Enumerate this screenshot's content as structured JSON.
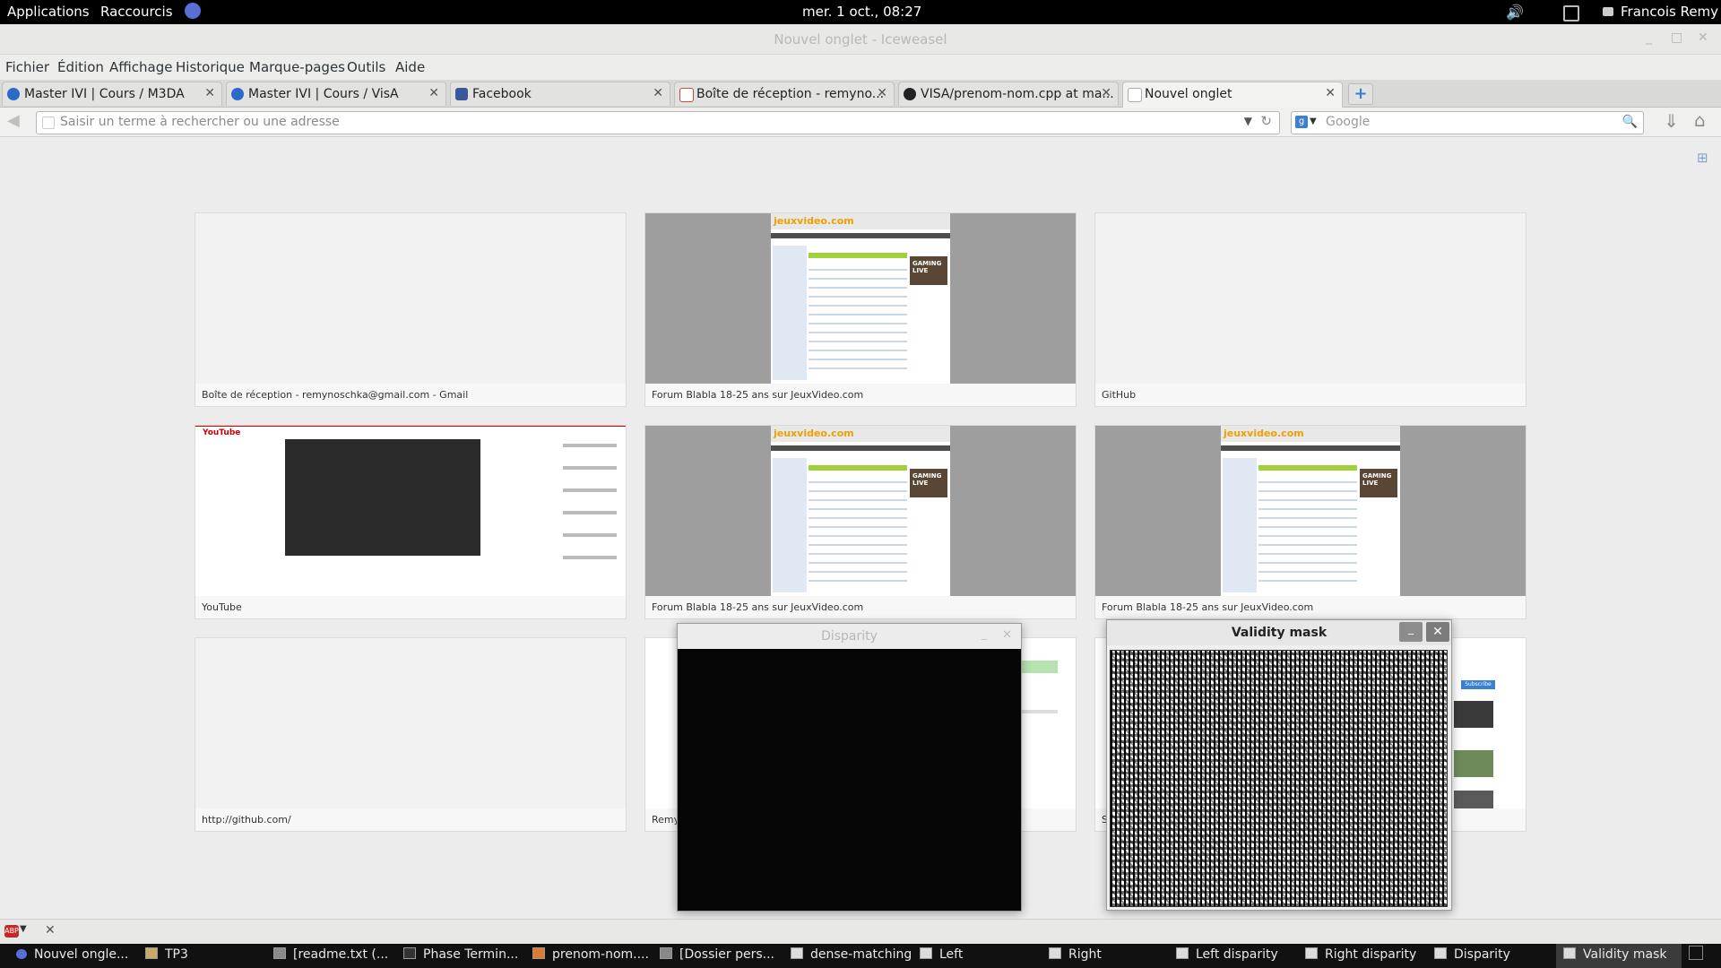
{
  "topbar": {
    "applications": "Applications",
    "shortcuts": "Raccourcis",
    "clock": "mer.  1 oct., 08:27",
    "user": "Francois Remy"
  },
  "window": {
    "title": "Nouvel onglet - Iceweasel"
  },
  "menubar": {
    "items": [
      "Fichier",
      "Édition",
      "Affichage",
      "Historique",
      "Marque-pages",
      "Outils",
      "Aide"
    ]
  },
  "tabs": [
    {
      "label": "Master IVI | Cours / M3DA",
      "icon": "site-icon",
      "color": "#2a6bc9"
    },
    {
      "label": "Master IVI | Cours / VisA",
      "icon": "site-icon",
      "color": "#2a6bc9"
    },
    {
      "label": "Facebook",
      "icon": "facebook-icon",
      "color": "#3b5998"
    },
    {
      "label": "Boîte de réception - remyno...",
      "icon": "gmail-icon",
      "color": "#d14836"
    },
    {
      "label": "VISA/prenom-nom.cpp at ma...",
      "icon": "github-icon",
      "color": "#222222"
    },
    {
      "label": "Nouvel onglet",
      "icon": "page-icon",
      "color": "#ffffff"
    }
  ],
  "navbar": {
    "url_placeholder": "Saisir un terme à rechercher ou une adresse",
    "search_placeholder": "Google"
  },
  "tiles": [
    {
      "caption": "Boîte de réception - remynoschka@gmail.com - Gmail",
      "kind": "blank"
    },
    {
      "caption": "Forum Blabla 18-25 ans sur JeuxVideo.com",
      "kind": "jv"
    },
    {
      "caption": "GitHub",
      "kind": "blank"
    },
    {
      "caption": "YouTube",
      "kind": "yt"
    },
    {
      "caption": "Forum Blabla 18-25 ans sur JeuxVideo.com",
      "kind": "jv"
    },
    {
      "caption": "Forum Blabla 18-25 ans sur JeuxVideo.com",
      "kind": "jv"
    },
    {
      "caption": "http://github.com/",
      "kind": "blank"
    },
    {
      "caption": "Remy",
      "kind": "partial"
    },
    {
      "caption": "S",
      "kind": "partial"
    }
  ],
  "thumbs": {
    "jv_logo": "jeuxvideo.com",
    "yt_logo": "YouTube",
    "jv_ad": "GAMING LIVE",
    "yt_sub": "Subscribe"
  },
  "windows": {
    "disparity": {
      "title": "Disparity"
    },
    "validity": {
      "title": "Validity mask"
    }
  },
  "taskbar": [
    {
      "label": "Nouvel ongle..."
    },
    {
      "label": "TP3"
    },
    {
      "label": "[readme.txt (..."
    },
    {
      "label": "Phase Termin..."
    },
    {
      "label": "prenom-nom...."
    },
    {
      "label": "[Dossier pers..."
    },
    {
      "label": "dense-matching"
    },
    {
      "label": "Left"
    },
    {
      "label": "Right"
    },
    {
      "label": "Left disparity"
    },
    {
      "label": "Right disparity"
    },
    {
      "label": "Disparity"
    },
    {
      "label": "Validity mask"
    }
  ]
}
